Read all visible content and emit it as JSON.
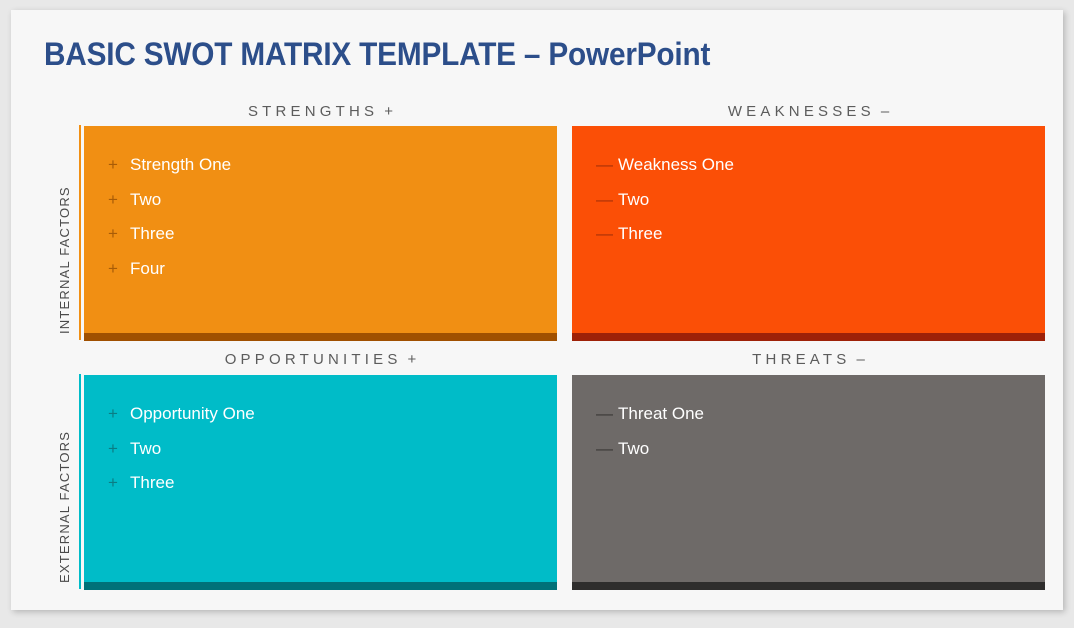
{
  "slide": {
    "title": "BASIC SWOT MATRIX TEMPLATE  –  PowerPoint",
    "background": "#f7f7f7",
    "title_color": "#2c4e8a"
  },
  "axes": [
    {
      "label": "INTERNAL FACTORS",
      "line_color": "#f18f13"
    },
    {
      "label": "EXTERNAL FACTORS",
      "line_color": "#00bcc8"
    }
  ],
  "quadrants": [
    {
      "key": "strengths",
      "heading": "STRENGTHS",
      "sign": "+",
      "marker": "+",
      "fill": "#f18f13",
      "accent": "#a05000",
      "marker_color": "#a85c07",
      "items": [
        "Strength One",
        "Two",
        "Three",
        "Four"
      ]
    },
    {
      "key": "weaknesses",
      "heading": "WEAKNESSES",
      "sign": "–",
      "marker": "—",
      "fill": "#fb4f06",
      "accent": "#9e2108",
      "marker_color": "#a83208",
      "items": [
        "Weakness One",
        "Two",
        "Three"
      ]
    },
    {
      "key": "opportunities",
      "heading": "OPPORTUNITIES",
      "sign": "+",
      "marker": "+",
      "fill": "#00bcc8",
      "accent": "#007178",
      "marker_color": "#0a7d84",
      "items": [
        "Opportunity One",
        "Two",
        "Three"
      ]
    },
    {
      "key": "threats",
      "heading": "THREATS",
      "sign": "–",
      "marker": "—",
      "fill": "#6e6a68",
      "accent": "#2e2d2c",
      "marker_color": "#3a3836",
      "items": [
        "Threat One",
        "Two"
      ]
    }
  ]
}
